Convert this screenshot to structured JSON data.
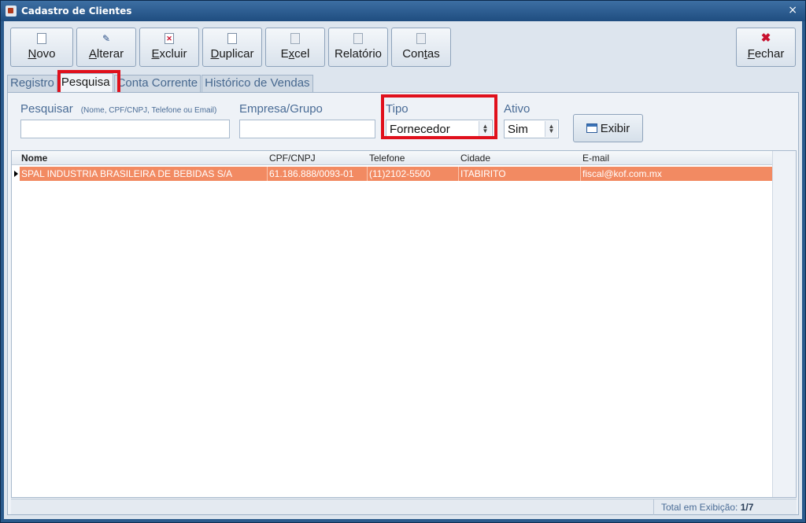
{
  "window": {
    "title": "Cadastro de Clientes",
    "close_glyph": "×"
  },
  "toolbar": {
    "buttons": [
      {
        "label": "Novo",
        "accel": "N",
        "rest": "ovo",
        "icon": "new-document-icon"
      },
      {
        "label": "Alterar",
        "accel": "A",
        "rest": "lterar",
        "icon": "edit-pencil-icon"
      },
      {
        "label": "Excluir",
        "accel": "E",
        "rest": "xcluir",
        "icon": "delete-document-icon"
      },
      {
        "label": "Duplicar",
        "accel": "D",
        "rest": "uplicar",
        "icon": "duplicate-icon"
      },
      {
        "label": "Excel",
        "pre": "E",
        "accel": "x",
        "rest": "cel",
        "icon": "excel-icon"
      },
      {
        "label": "Relatório",
        "icon": "report-icon"
      },
      {
        "label": "Contas",
        "pre": "Con",
        "accel": "t",
        "rest": "as",
        "icon": "accounts-icon"
      },
      {
        "label": "Fechar",
        "accel": "F",
        "rest": "echar",
        "icon": "close-red-x-icon"
      }
    ]
  },
  "tabs": [
    {
      "label": "Registro",
      "active": false
    },
    {
      "label": "Pesquisa",
      "active": true
    },
    {
      "label": "Conta Corrente",
      "active": false
    },
    {
      "label": "Histórico de Vendas",
      "active": false
    }
  ],
  "search": {
    "pesquisar_label": "Pesquisar",
    "pesquisar_hint": "(Nome, CPF/CNPJ, Telefone ou Email)",
    "pesquisar_value": "",
    "empresa_label": "Empresa/Grupo",
    "empresa_value": "",
    "tipo_label": "Tipo",
    "tipo_value": "Fornecedor",
    "ativo_label": "Ativo",
    "ativo_value": "Sim",
    "exibir_label": "Exibir"
  },
  "grid": {
    "columns": [
      "Nome",
      "CPF/CNPJ",
      "Telefone",
      "Cidade",
      "E-mail"
    ],
    "rows": [
      [
        "SPAL INDUSTRIA BRASILEIRA DE BEBIDAS S/A",
        "61.186.888/0093-01",
        "(11)2102-5500",
        "ITABIRITO",
        "fiscal@kof.com.mx"
      ]
    ],
    "selected_row_color": "#f28a62"
  },
  "status": {
    "label": "Total em Exibição:",
    "value": "1/7"
  },
  "colors": {
    "highlight": "#e0101c",
    "accent_label": "#4a6c96",
    "title_bar": "#2a5a8c"
  }
}
